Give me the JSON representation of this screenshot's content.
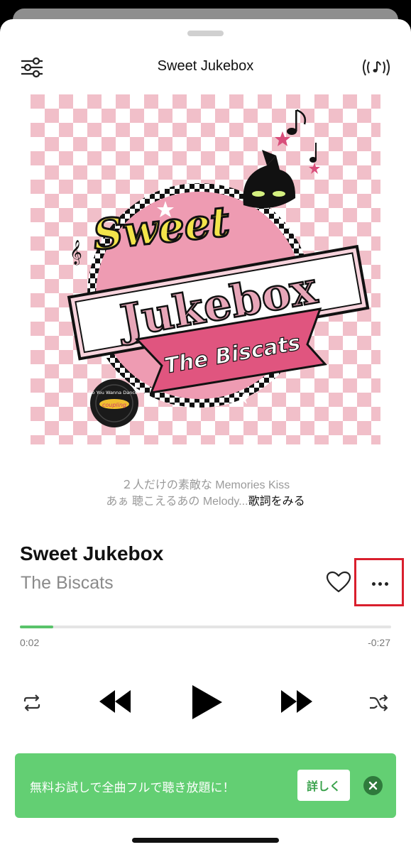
{
  "header": {
    "title": "Sweet Jukebox",
    "left_icon": "equalizer-sliders-icon",
    "right_icon": "cast-music-icon"
  },
  "artwork": {
    "logo_word1": "Sweet",
    "logo_word2": "Jukebox",
    "logo_band": "The Biscats",
    "record_label": "Do You Wanna Dance?",
    "record_sub": "coupling",
    "colors": {
      "checker": "#f1bfc9",
      "circle": "#ee9bb2",
      "ribbon": "#e0557f"
    }
  },
  "lyrics": {
    "line1": "２人だけの素敵な Memories Kiss",
    "line2": "あぁ 聴こえるあの Melody...",
    "more_link": "歌詞をみる"
  },
  "song": {
    "title": "Sweet Jukebox",
    "artist": "The Biscats"
  },
  "progress": {
    "elapsed": "0:02",
    "remaining": "-0:27",
    "fraction": 0.09
  },
  "controls": {
    "repeat_icon": "repeat-icon",
    "prev_icon": "rewind-icon",
    "play_icon": "play-icon",
    "next_icon": "fast-forward-icon",
    "shuffle_icon": "shuffle-icon"
  },
  "banner": {
    "text": "無料お試しで全曲フルで聴き放題に！",
    "button": "詳しく",
    "close_icon": "close-icon"
  },
  "colors": {
    "accent_green": "#59c36a",
    "banner_green": "#63cf73",
    "highlight_red": "#d91f2d"
  }
}
